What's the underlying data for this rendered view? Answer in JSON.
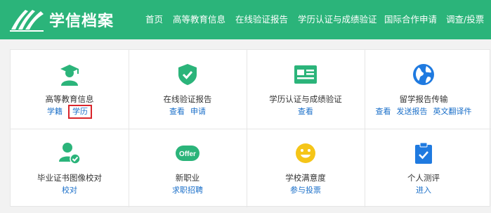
{
  "header": {
    "logo_text": "学信档案",
    "nav": [
      "首页",
      "高等教育信息",
      "在线验证报告",
      "学历认证与成绩验证",
      "国际合作申请",
      "调查/投票"
    ]
  },
  "colors": {
    "brand": "#2bb47a",
    "link": "#1a6fc9",
    "highlight": "#d9252b",
    "yellow": "#f5c518",
    "blue": "#1f7ae0"
  },
  "tiles": [
    {
      "title": "高等教育信息",
      "icon": "graduate-icon",
      "links": [
        "学籍",
        "学历"
      ]
    },
    {
      "title": "在线验证报告",
      "icon": "shield-check-icon",
      "links": [
        "查看",
        "申请"
      ]
    },
    {
      "title": "学历认证与成绩验证",
      "icon": "id-card-icon",
      "links": [
        "查看"
      ]
    },
    {
      "title": "留学报告传输",
      "icon": "globe-icon",
      "links": [
        "查看",
        "发送报告",
        "英文翻译件"
      ]
    },
    {
      "title": "毕业证书图像校对",
      "icon": "user-check-icon",
      "links": [
        "校对"
      ]
    },
    {
      "title": "新职业",
      "icon": "offer-badge-icon",
      "links": [
        "求职招聘"
      ],
      "badge_text": "Offer"
    },
    {
      "title": "学校满意度",
      "icon": "smiley-icon",
      "links": [
        "参与投票"
      ]
    },
    {
      "title": "个人测评",
      "icon": "clipboard-check-icon",
      "links": [
        "进入"
      ]
    }
  ]
}
